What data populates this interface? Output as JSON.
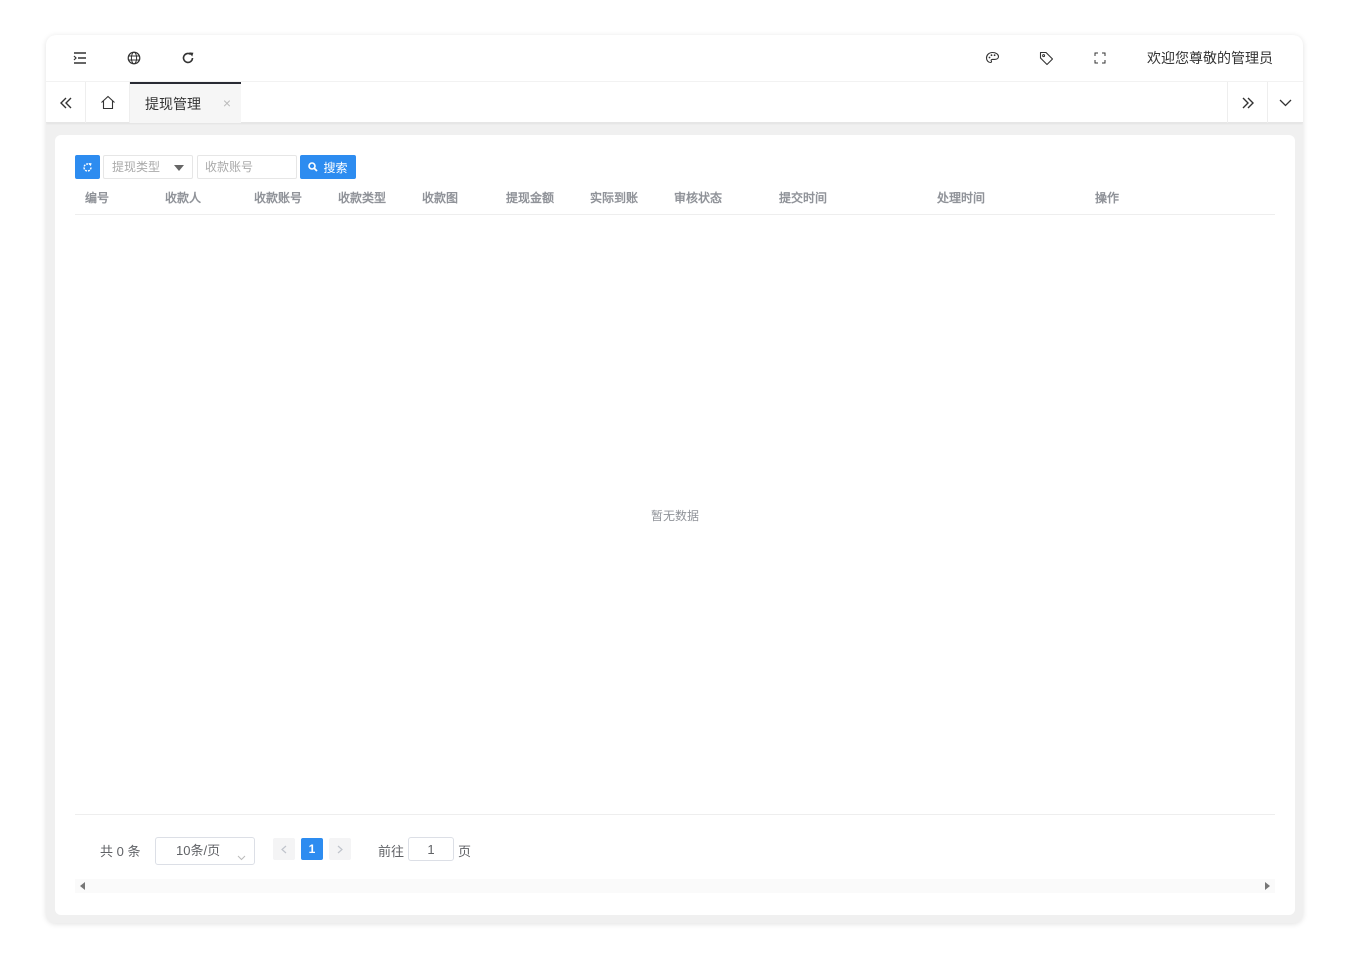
{
  "header": {
    "icons": {
      "menu_toggle": "indent-icon",
      "website": "globe-icon",
      "refresh": "refresh-icon",
      "theme": "palette-icon",
      "tag": "tag-icon",
      "fullscreen": "fullscreen-icon"
    },
    "welcome_text": "欢迎您尊敬的管理员"
  },
  "tabbar": {
    "active_tab": "提现管理",
    "close_glyph": "×"
  },
  "toolbar": {
    "type_select_placeholder": "提现类型",
    "account_input_placeholder": "收款账号",
    "search_label": "搜索"
  },
  "table": {
    "columns": [
      "编号",
      "收款人",
      "收款账号",
      "收款类型",
      "收款图",
      "提现金额",
      "实际到账",
      "审核状态",
      "提交时间",
      "处理时间",
      "操作"
    ],
    "rows": [],
    "empty_text": "暂无数据"
  },
  "pagination": {
    "total_text": "共 0 条",
    "page_size": "10条/页",
    "current_page": "1",
    "goto_prefix": "前往",
    "goto_value": "1",
    "goto_suffix": "页"
  },
  "colors": {
    "primary": "#2d8cf0",
    "tab_indicator": "#292b34"
  }
}
